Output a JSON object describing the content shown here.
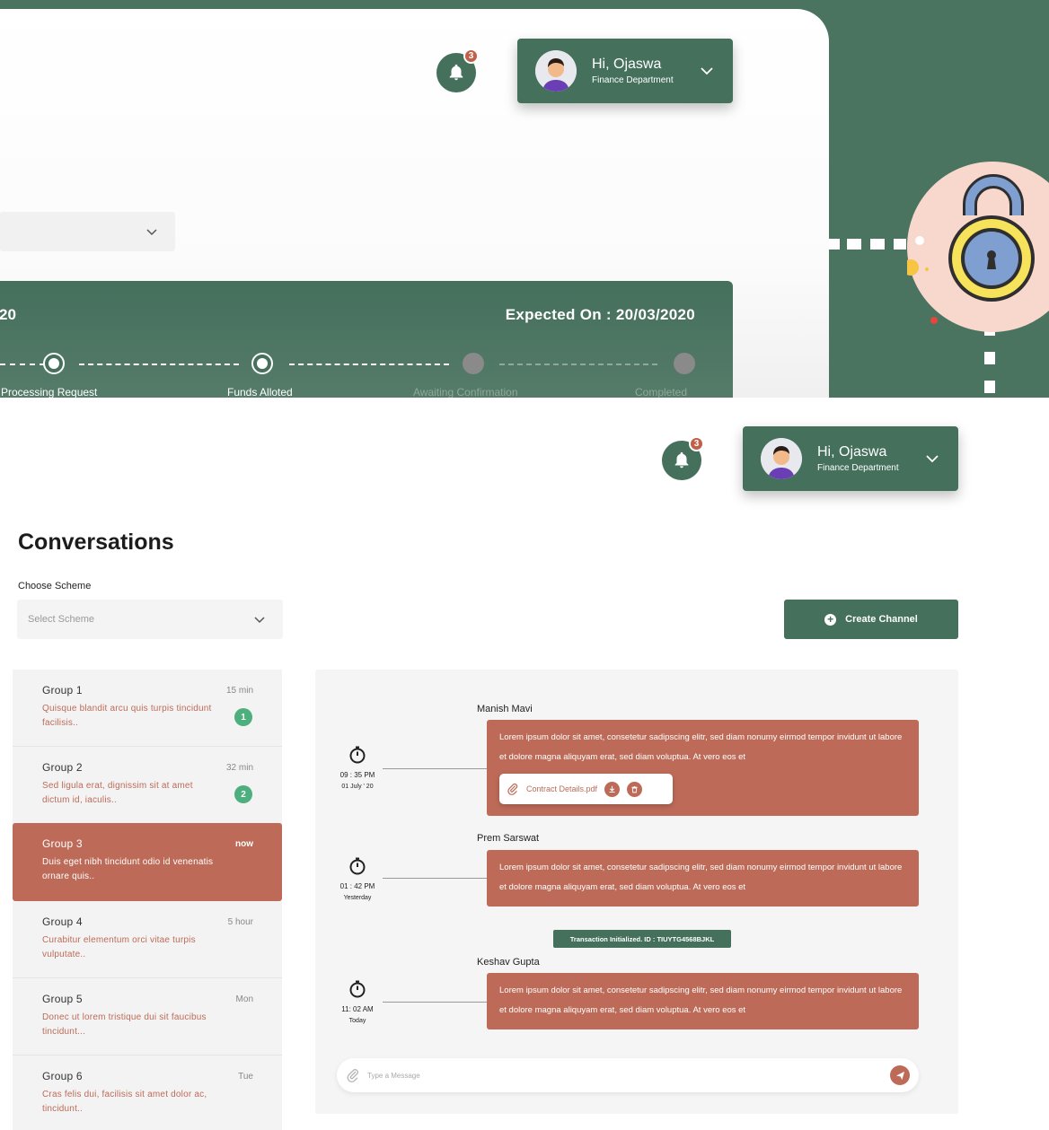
{
  "back_panel": {
    "notification_count": "3",
    "user": {
      "greeting": "Hi, Ojaswa",
      "department": "Finance Department"
    },
    "tracker": {
      "left_text": "20",
      "expected": "Expected On : 20/03/2020",
      "stages": [
        {
          "label": "Processing Request",
          "state": "done"
        },
        {
          "label": "Funds Alloted",
          "state": "done"
        },
        {
          "label": "Awaiting Confirmation",
          "state": "pending"
        },
        {
          "label": "Completed",
          "state": "pending"
        }
      ]
    }
  },
  "header": {
    "notification_count": "3",
    "user": {
      "greeting": "Hi, Ojaswa",
      "department": "Finance Department"
    }
  },
  "main": {
    "title": "Conversations",
    "scheme_label": "Choose Scheme",
    "scheme_placeholder": "Select Scheme",
    "create_channel": "Create Channel"
  },
  "groups": [
    {
      "name": "Group 1",
      "time": "15 min",
      "preview": "Quisque blandit arcu quis turpis tincidunt facilisis..",
      "count": "1"
    },
    {
      "name": "Group 2",
      "time": "32 min",
      "preview": "Sed ligula erat, dignissim sit at amet dictum id, iaculis..",
      "count": "2"
    },
    {
      "name": "Group 3",
      "time": "now",
      "preview": "Duis eget nibh tincidunt odio id venenatis ornare quis..",
      "count": ""
    },
    {
      "name": "Group 4",
      "time": "5 hour",
      "preview": "Curabitur elementum orci vitae turpis vulputate..",
      "count": ""
    },
    {
      "name": "Group 5",
      "time": "Mon",
      "preview": "Donec ut lorem tristique dui sit faucibus tincidunt...",
      "count": ""
    },
    {
      "name": "Group 6",
      "time": "Tue",
      "preview": "Cras felis dui, facilisis sit amet dolor ac, tincidunt..",
      "count": ""
    }
  ],
  "messages": [
    {
      "sender": "Manish Mavi",
      "time": "09 : 35 PM",
      "day": "01 July ' 20",
      "text": "Lorem ipsum dolor sit amet, consetetur sadipscing elitr, sed diam nonumy eirmod tempor invidunt ut labore et dolore magna aliquyam erat, sed diam voluptua. At vero eos et",
      "attachment": "Contract Details.pdf"
    },
    {
      "sender": "Prem Sarswat",
      "time": "01 : 42 PM",
      "day": "Yesterday",
      "text": "Lorem ipsum dolor sit amet, consetetur sadipscing elitr, sed diam nonumy eirmod tempor invidunt ut labore et dolore magna aliquyam erat, sed diam voluptua. At vero eos et"
    },
    {
      "sender": "Keshav Gupta",
      "time": "11: 02 AM",
      "day": "Today",
      "text": "Lorem ipsum dolor sit amet, consetetur sadipscing elitr, sed diam nonumy eirmod tempor invidunt ut labore et dolore magna aliquyam erat, sed diam voluptua. At vero eos et"
    }
  ],
  "transaction_badge": "Transaction Initialized. ID : TIUYTG4568BJKL",
  "composer": {
    "placeholder": "Type a Message"
  },
  "colors": {
    "primary_green": "#44705c",
    "accent_terracotta": "#bd6b58",
    "badge_green": "#4caf7d"
  }
}
